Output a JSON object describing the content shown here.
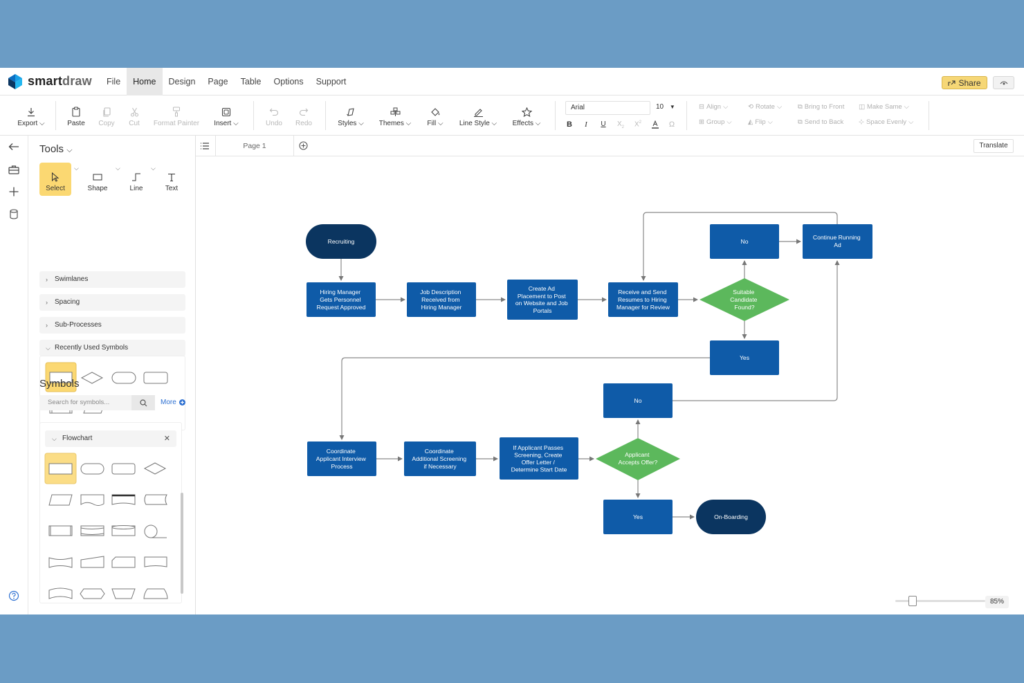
{
  "app": {
    "brand_smart": "smart",
    "brand_draw": "draw"
  },
  "menu": [
    "File",
    "Home",
    "Design",
    "Page",
    "Table",
    "Options",
    "Support"
  ],
  "share_label": "Share",
  "toolbar": {
    "export": "Export",
    "paste": "Paste",
    "copy": "Copy",
    "cut": "Cut",
    "format_painter": "Format Painter",
    "insert": "Insert",
    "undo": "Undo",
    "redo": "Redo",
    "styles": "Styles",
    "themes": "Themes",
    "fill": "Fill",
    "line_style": "Line Style",
    "effects": "Effects",
    "font": "Arial",
    "font_size": "10",
    "align": "Align",
    "rotate": "Rotate",
    "bring_front": "Bring to Front",
    "make_same": "Make Same",
    "group": "Group",
    "flip": "Flip",
    "send_back": "Send to Back",
    "space_evenly": "Space Evenly"
  },
  "panel": {
    "tools_title": "Tools",
    "tools": [
      "Select",
      "Shape",
      "Line",
      "Text"
    ],
    "sections": [
      "Swimlanes",
      "Spacing",
      "Sub-Processes",
      "Recently Used Symbols"
    ],
    "symbols_title": "Symbols",
    "search_placeholder": "Search for symbols...",
    "more": "More",
    "library": "Flowchart"
  },
  "tabs": {
    "page": "Page 1",
    "translate": "Translate"
  },
  "zoom": "85%",
  "colors": {
    "process": "#0f5ba8",
    "terminal": "#0b3560",
    "decision": "#5cb85c",
    "accent": "#fbd872"
  },
  "diagram": {
    "recruiting": "Recruiting",
    "hiring_manager": [
      "Hiring Manager",
      "Gets Personnel",
      "Request Approved"
    ],
    "job_description": [
      "Job Description",
      "Received from",
      "Hiring Manager"
    ],
    "create_ad": [
      "Create Ad",
      "Placement to Post",
      "on Website and Job",
      "Portals"
    ],
    "receive_send": [
      "Receive and Send",
      "Resumes to Hiring",
      "Manager for Review"
    ],
    "suitable": [
      "Suitable",
      "Candidate",
      "Found?"
    ],
    "no_top": "No",
    "continue_running": [
      "Continue Running",
      "Ad"
    ],
    "yes_top": "Yes",
    "no_mid": "No",
    "coordinate_interview": [
      "Coordinate",
      "Applicant Interview",
      "Process"
    ],
    "coordinate_screening": [
      "Coordinate",
      "Additional Screening",
      "if Necessary"
    ],
    "if_applicant": [
      "If Applicant Passes",
      "Screening, Create",
      "Offer Letter /",
      "Determine Start Date"
    ],
    "accepts": [
      "Applicant",
      "Accepts Offer?"
    ],
    "yes_bottom": "Yes",
    "onboarding": "On-Boarding"
  }
}
